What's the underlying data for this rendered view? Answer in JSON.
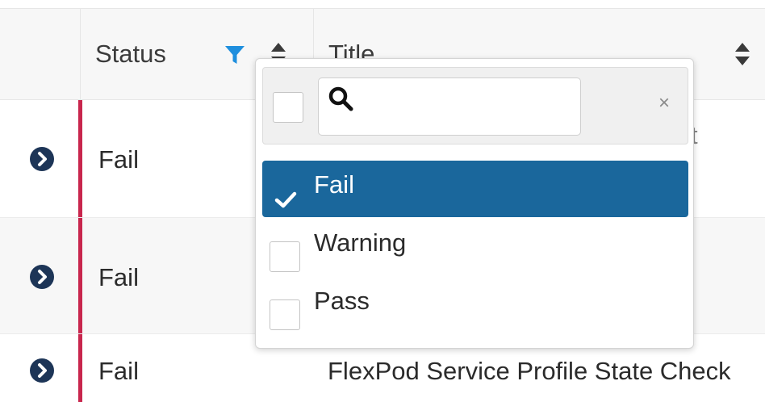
{
  "header": {
    "status_label": "Status",
    "title_label": "Title"
  },
  "rows": [
    {
      "status": "Fail",
      "title": ""
    },
    {
      "status": "Fail",
      "title": ""
    },
    {
      "status": "Fail",
      "title": "FlexPod Service Profile State Check"
    }
  ],
  "title_peek": "t",
  "filter_dropdown": {
    "search": {
      "value": "",
      "placeholder": ""
    },
    "clear_symbol": "×",
    "options": [
      {
        "label": "Fail",
        "checked": true
      },
      {
        "label": "Warning",
        "checked": false
      },
      {
        "label": "Pass",
        "checked": false
      }
    ]
  },
  "colors": {
    "accent": "#1a679c",
    "filter_icon": "#1f8fde",
    "fail_bar": "#c8264d",
    "expand_button": "#1d3557"
  },
  "icons": {
    "expand": "chevron-right-circle-icon",
    "filter": "funnel-icon",
    "sort": "sort-up-down-icon",
    "search": "magnifier-icon",
    "check": "checkmark-icon"
  }
}
